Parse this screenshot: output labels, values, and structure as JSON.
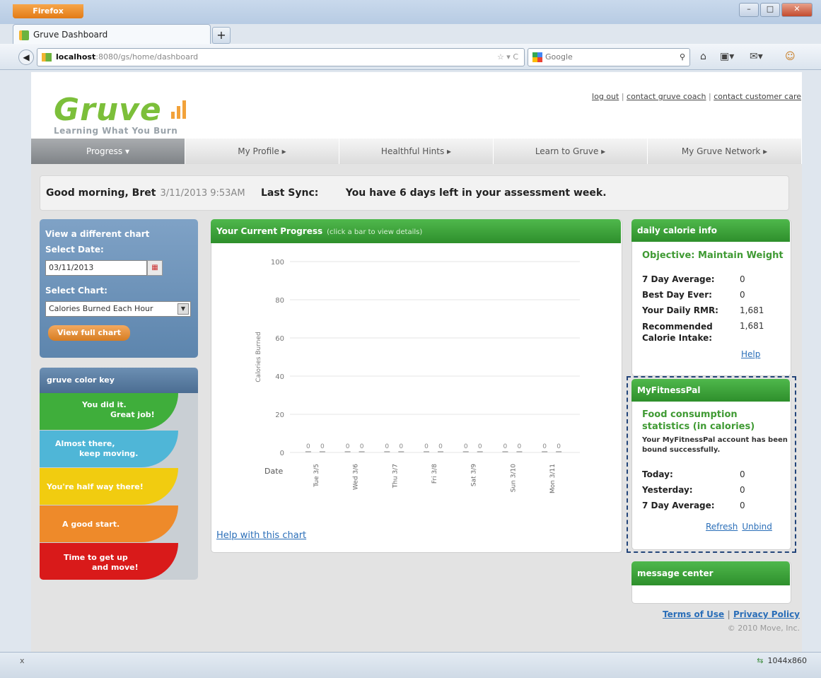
{
  "browser": {
    "app_button": "Firefox",
    "tab_title": "Gruve Dashboard",
    "new_tab": "+",
    "url_host": "localhost",
    "url_path": ":8080/gs/home/dashboard",
    "search_placeholder": "Google",
    "status_left": "x",
    "status_size": "1044x860"
  },
  "header": {
    "logo_text": "Gruve",
    "tagline": "Learning What You Burn",
    "links": [
      "log out",
      "contact gruve coach",
      "contact customer care"
    ],
    "separator": "|"
  },
  "nav": [
    {
      "label": "Progress  ▾",
      "active": true
    },
    {
      "label": "My Profile  ▸",
      "active": false
    },
    {
      "label": "Healthful Hints  ▸",
      "active": false
    },
    {
      "label": "Learn to Gruve  ▸",
      "active": false
    },
    {
      "label": "My Gruve Network  ▸",
      "active": false
    }
  ],
  "greeting": {
    "text": "Good morning, Bret",
    "datetime": "3/11/2013 9:53AM",
    "last_sync": "Last Sync:",
    "message": "You have 6 days left in your assessment week."
  },
  "chart_selector": {
    "heading": "View a different chart",
    "date_label": "Select Date:",
    "date_value": "03/11/2013",
    "chart_label": "Select Chart:",
    "chart_value": "Calories Burned Each Hour",
    "button": "View full chart"
  },
  "color_key": {
    "title": "gruve color key",
    "bands": [
      {
        "line1": "You did it.",
        "line2": "Great job!",
        "color": "#3fae3b"
      },
      {
        "line1": "Almost there,",
        "line2": "keep moving.",
        "color": "#4fb6d7"
      },
      {
        "line1": "You're half way there!",
        "line2": "",
        "color": "#f1cc10"
      },
      {
        "line1": "A good start.",
        "line2": "",
        "color": "#ee8a2a"
      },
      {
        "line1": "Time to get up",
        "line2": "and move!",
        "color": "#d91a1a"
      }
    ]
  },
  "progress": {
    "title": "Your Current Progress",
    "hint": "(click a bar to view details)",
    "help_link": "Help with this chart"
  },
  "chart_data": {
    "type": "bar",
    "title": "",
    "ylabel": "Calories Burned",
    "xlabel": "Date",
    "ylim": [
      0,
      100
    ],
    "yticks": [
      0,
      20,
      40,
      60,
      80,
      100
    ],
    "categories": [
      "Tue 3/5",
      "Wed 3/6",
      "Thu 3/7",
      "Fri 3/8",
      "Sat 3/9",
      "Sun 3/10",
      "Mon 3/11"
    ],
    "series": [
      {
        "values": [
          0,
          0,
          0,
          0,
          0,
          0,
          0
        ]
      },
      {
        "values": [
          0,
          0,
          0,
          0,
          0,
          0,
          0
        ]
      }
    ],
    "grid": true
  },
  "calorie_info": {
    "title": "daily calorie info",
    "objective": "Objective: Maintain Weight",
    "rows": [
      {
        "label": "7 Day Average:",
        "value": "0"
      },
      {
        "label": "Best Day Ever:",
        "value": "0"
      },
      {
        "label": "Your Daily RMR:",
        "value": "1,681"
      },
      {
        "label": "Recommended Calorie Intake:",
        "value": "1,681"
      }
    ],
    "help": "Help"
  },
  "myfitnesspal": {
    "title": "MyFitnessPal",
    "subtitle": "Food consumption statistics (in calories)",
    "note": "Your MyFitnessPal account has been bound successfully.",
    "rows": [
      {
        "label": "Today:",
        "value": "0"
      },
      {
        "label": "Yesterday:",
        "value": "0"
      },
      {
        "label": "7 Day Average:",
        "value": "0"
      }
    ],
    "refresh": "Refresh",
    "unbind": "Unbind"
  },
  "message_center": {
    "title": "message center"
  },
  "footer": {
    "terms": "Terms of Use",
    "privacy": "Privacy Policy",
    "copyright": "© 2010 Move, Inc."
  },
  "colors": {
    "brand_green": "#7cbf3a",
    "panel_green": "#3aa336",
    "link_blue": "#2a6eb8"
  }
}
